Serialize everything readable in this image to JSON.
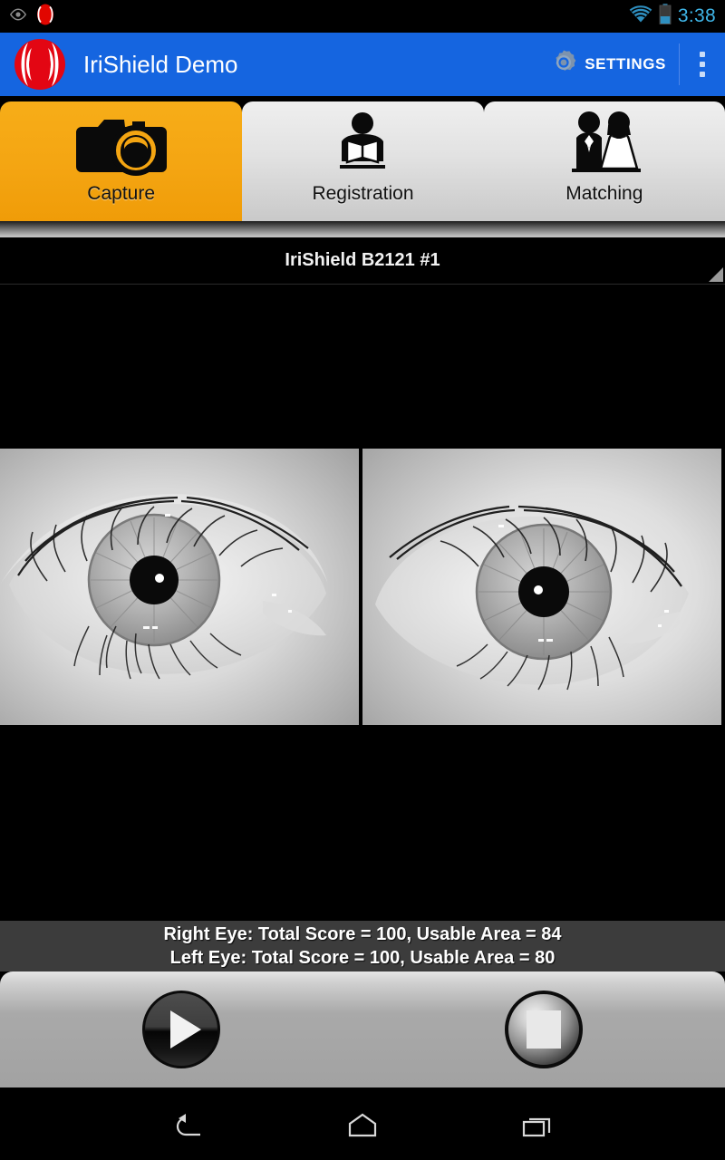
{
  "status_bar": {
    "notification_icons": [
      "eye-icon",
      "irishield-logo-icon"
    ],
    "wifi_icon": "wifi-icon",
    "battery_icon": "battery-icon",
    "time": "3:38",
    "time_color": "#3fb6e8"
  },
  "app_bar": {
    "logo_icon": "irishield-logo-icon",
    "title": "IriShield Demo",
    "settings_icon": "gear-icon",
    "settings_label": "SETTINGS",
    "overflow_icon": "overflow-menu-icon",
    "background_color": "#1565e0"
  },
  "tabs": [
    {
      "label": "Capture",
      "icon": "camera-icon",
      "active": true
    },
    {
      "label": "Registration",
      "icon": "person-reading-icon",
      "active": false
    },
    {
      "label": "Matching",
      "icon": "couple-icon",
      "active": false
    }
  ],
  "tab_active_color": "#f4a512",
  "device": {
    "label": "IriShield B2121 #1",
    "caret_icon": "dropdown-caret-icon"
  },
  "preview": {
    "left_image_alt": "right-eye-iris-image",
    "right_image_alt": "left-eye-iris-image"
  },
  "status_text": {
    "line1": "Right Eye: Total Score = 100, Usable Area = 84",
    "line2": "Left Eye: Total Score = 100, Usable Area = 80",
    "background_color": "#3c3c3c"
  },
  "controls": {
    "play_icon": "play-icon",
    "stop_icon": "stop-icon"
  },
  "navigation_bar": {
    "back_icon": "back-icon",
    "home_icon": "home-icon",
    "recents_icon": "recents-icon"
  }
}
